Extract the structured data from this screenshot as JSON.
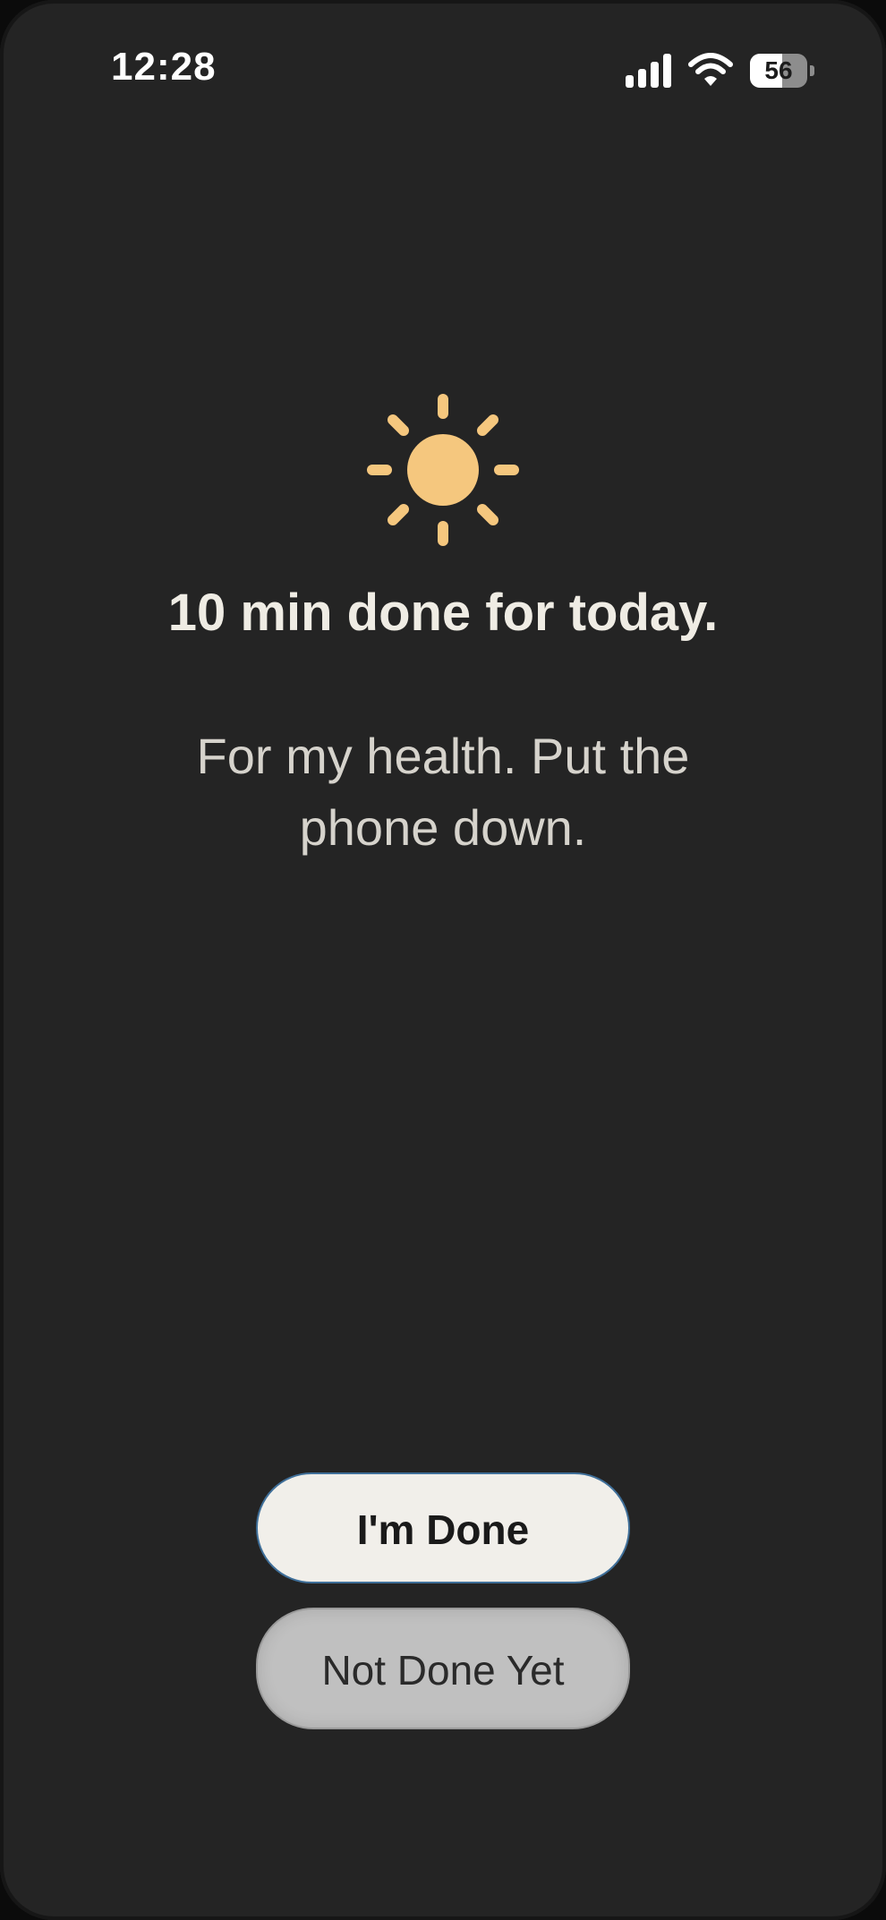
{
  "status_bar": {
    "time": "12:28",
    "battery_level": "56",
    "battery_fraction": 0.56,
    "icons": [
      "signal-icon",
      "wifi-icon",
      "battery-icon"
    ]
  },
  "main": {
    "icon": "sun-icon",
    "headline": "10 min done for today.",
    "subtext": "For my health. Put the phone down."
  },
  "actions": {
    "primary_label": "I'm Done",
    "secondary_label": "Not Done Yet"
  },
  "colors": {
    "background": "#242424",
    "sun": "#f5c77e",
    "primary_button": "#f1efea",
    "secondary_button": "#c0c0c0",
    "headline_text": "#efece4"
  }
}
